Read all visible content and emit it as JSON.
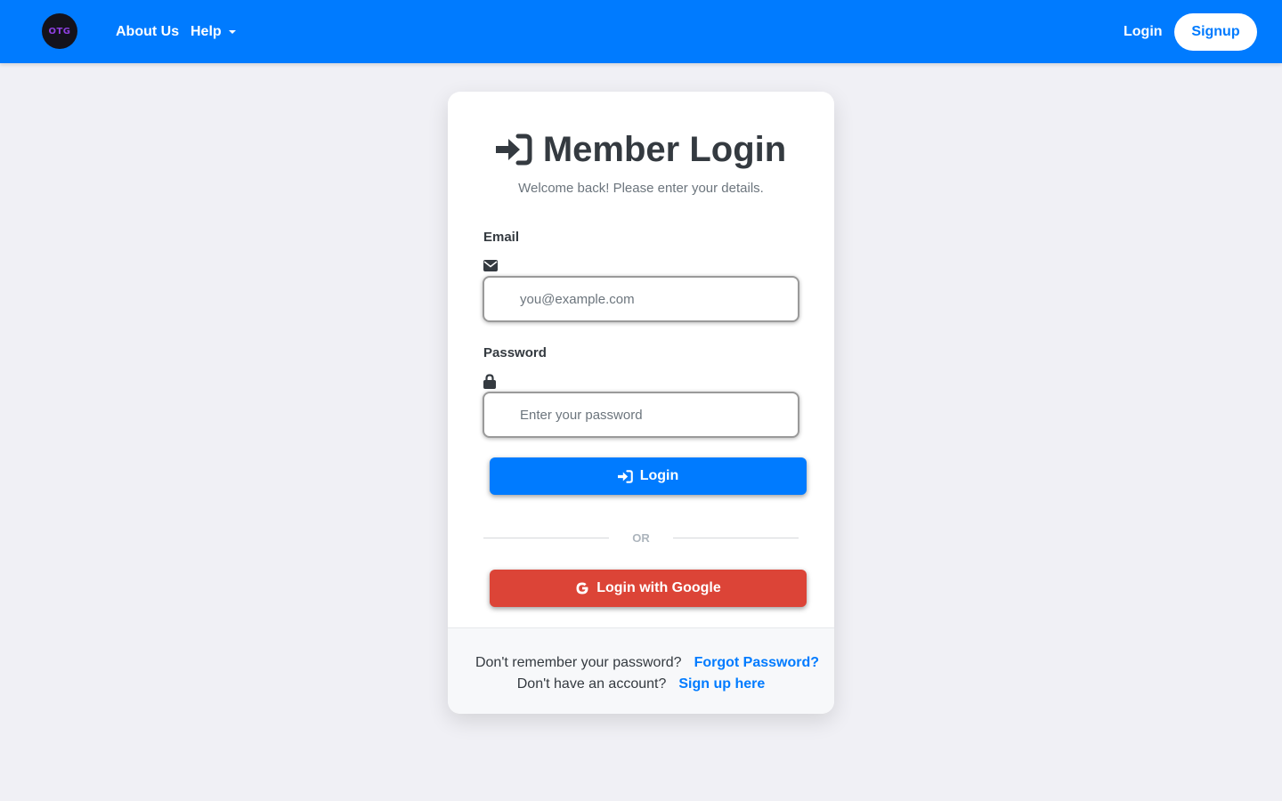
{
  "nav": {
    "logo_text": "OTG",
    "about_label": "About Us",
    "help_label": "Help",
    "login_label": "Login",
    "signup_label": "Signup"
  },
  "card": {
    "title": "Member Login",
    "subtitle": "Welcome back! Please enter your details.",
    "email_label": "Email",
    "email_placeholder": "you@example.com",
    "password_label": "Password",
    "password_placeholder": "Enter your password",
    "login_button": "Login",
    "divider_text": "OR",
    "google_button": "Login with Google"
  },
  "footer": {
    "forgot_prompt": "Don't remember your password?",
    "forgot_link": "Forgot Password?",
    "signup_prompt": "Don't have an account?",
    "signup_link": "Sign up here"
  },
  "colors": {
    "primary": "#007bff",
    "google": "#dc4437",
    "background": "#f0f0f5",
    "text": "#343a40"
  },
  "icons": {
    "title": "sign-in-icon",
    "email": "envelope-icon",
    "password": "lock-icon",
    "login_button": "sign-in-icon",
    "google_button": "google-icon",
    "help_dropdown": "caret-down-icon"
  }
}
